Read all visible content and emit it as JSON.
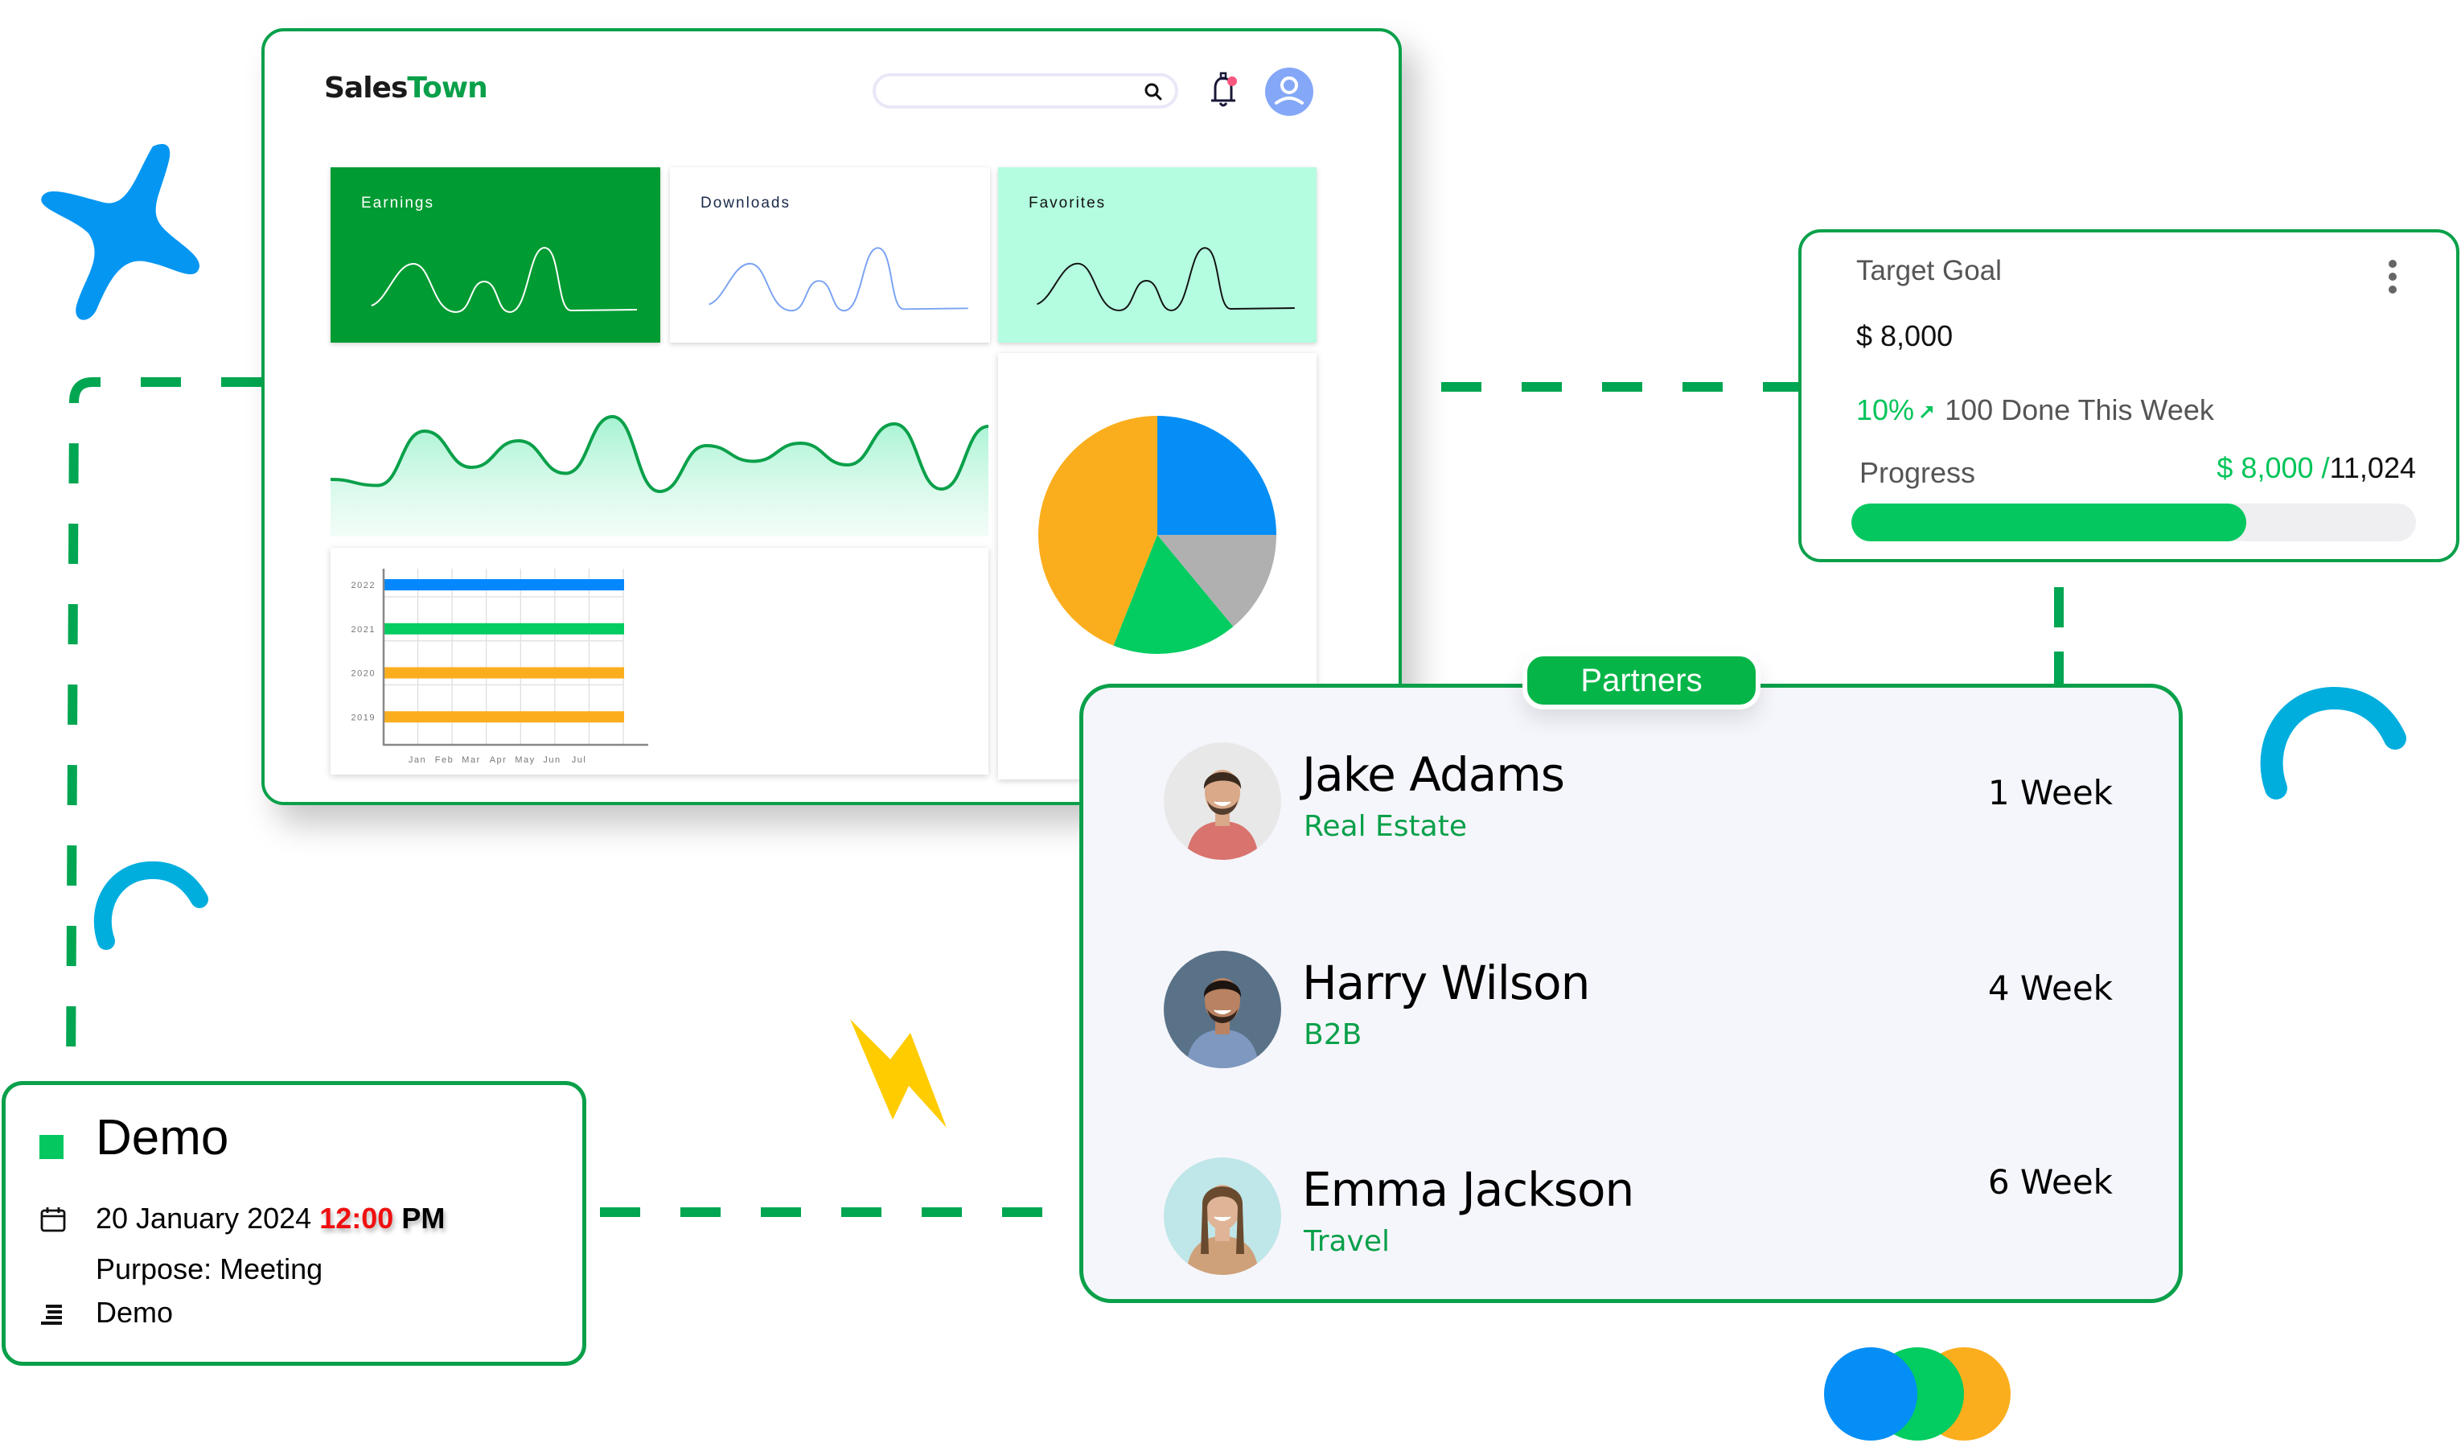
{
  "colors": {
    "brand_green": "#0aa04a",
    "accent_green": "#04c85f",
    "blue": "#058ef5",
    "orange": "#fbae1d",
    "gray": "#b0b0b0",
    "cyan": "#00aede",
    "yellow": "#ffcc00",
    "red": "#f01010"
  },
  "dashboard": {
    "logo": {
      "part1": "Sales",
      "part2": "Town"
    },
    "search": {
      "placeholder": "",
      "value": "",
      "icon": "search-icon"
    },
    "notification_icon": "bell-icon",
    "avatar_icon": "user-icon",
    "stat_cards": [
      {
        "label": "Earnings",
        "bg": "#009b32",
        "text": "#ffffff",
        "line": "#ffffff"
      },
      {
        "label": "Downloads",
        "bg": "#ffffff",
        "text": "#1a2a4a",
        "line": "#7aa2f2"
      },
      {
        "label": "Favorites",
        "bg": "#b4fde0",
        "text": "#111111",
        "line": "#111111"
      }
    ]
  },
  "chart_data": [
    {
      "type": "line",
      "title": "",
      "series": [
        {
          "name": "trend",
          "values": [
            0.3,
            0.25,
            0.7,
            0.4,
            0.62,
            0.35,
            0.82,
            0.2,
            0.58,
            0.45,
            0.6,
            0.42,
            0.76,
            0.22,
            0.74
          ]
        }
      ],
      "xlabel": "",
      "ylabel": "",
      "grid": false
    },
    {
      "type": "bar",
      "orientation": "horizontal",
      "categories": [
        "2022",
        "2021",
        "2020",
        "2019"
      ],
      "x_tick_labels": [
        "Jan",
        "Feb",
        "Mar",
        "Apr",
        "May",
        "Jun",
        "Jul"
      ],
      "values": [
        7,
        7,
        7,
        7
      ],
      "colors": [
        "#0588fd",
        "#03cc60",
        "#fbae1d",
        "#fbae1d"
      ],
      "xlim": [
        0,
        7
      ],
      "grid": true
    },
    {
      "type": "pie",
      "slices": [
        {
          "label": "blue",
          "value": 25,
          "color": "#058ef5"
        },
        {
          "label": "gray",
          "value": 14,
          "color": "#b0b0b0"
        },
        {
          "label": "green",
          "value": 17,
          "color": "#03cc60"
        },
        {
          "label": "orange",
          "value": 44,
          "color": "#fbae1d"
        }
      ]
    }
  ],
  "target_goal": {
    "title": "Target Goal",
    "amount": "$ 8,000",
    "change_pct": "10%",
    "change_icon": "arrow-up-right-icon",
    "week_text": "100 Done This Week",
    "progress_label": "Progress",
    "progress_current": "$ 8,000",
    "progress_separator": "/",
    "progress_total": "11,024",
    "progress_fraction": 0.7,
    "menu_icon": "kebab-menu-icon"
  },
  "partners": {
    "badge": "Partners",
    "items": [
      {
        "name": "Jake Adams",
        "role": "Real Estate",
        "duration": "1 Week",
        "avatar_bg": "#e8e8e8",
        "shirt": "#d9736e",
        "hair": "#3b2a1e",
        "skin": "#d9a98a"
      },
      {
        "name": "Harry Wilson",
        "role": "B2B",
        "duration": "4 Week",
        "avatar_bg": "#5a7288",
        "shirt": "#7e98c0",
        "hair": "#1c1410",
        "skin": "#b98262"
      },
      {
        "name": "Emma Jackson",
        "role": "Travel",
        "duration": "6 Week",
        "avatar_bg": "#bfe6e8",
        "shirt": "#cfa17a",
        "hair": "#6a4a2e",
        "skin": "#e0b496"
      }
    ]
  },
  "demo": {
    "title": "Demo",
    "date": "20 January 2024",
    "time": "12:00",
    "meridiem": "PM",
    "purpose": "Purpose: Meeting",
    "notes": "Demo",
    "date_icon": "calendar-icon",
    "notes_icon": "align-lines-icon"
  }
}
